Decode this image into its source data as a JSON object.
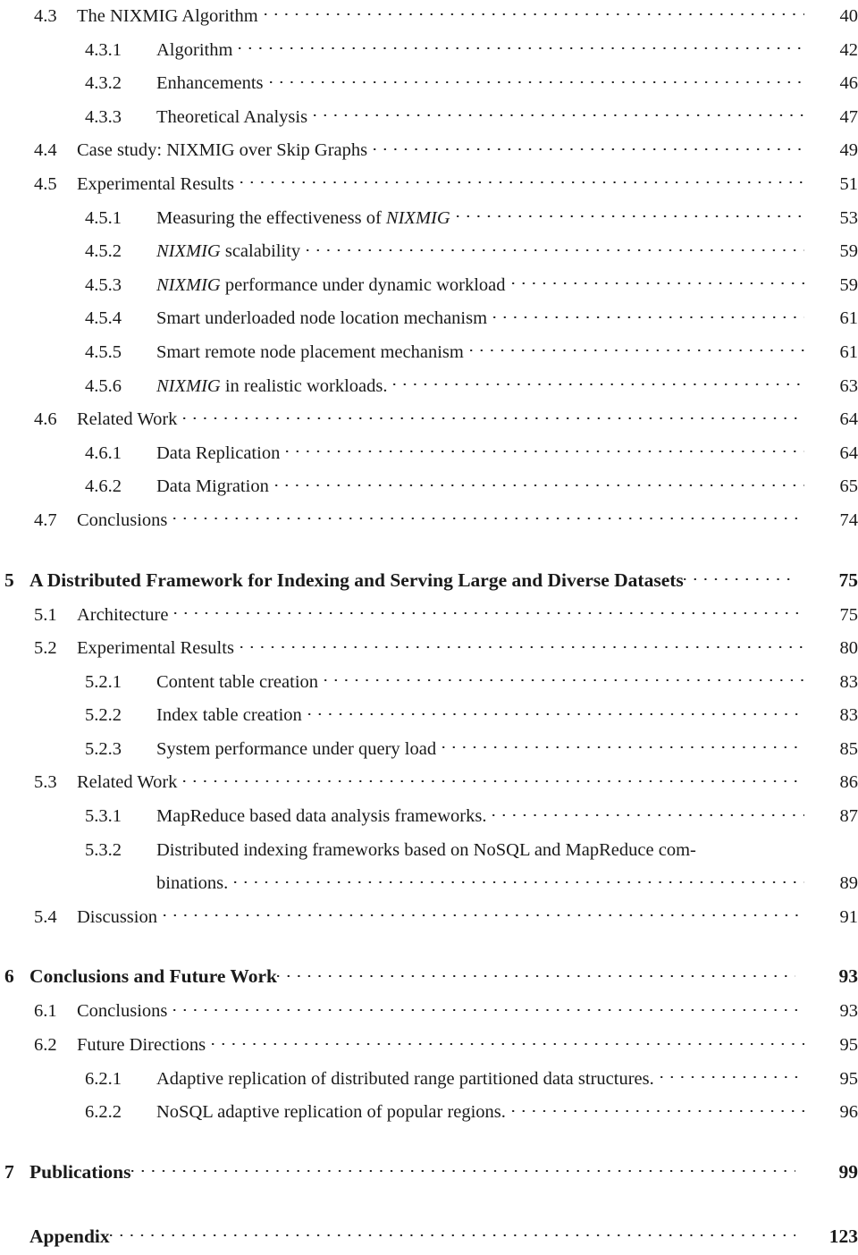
{
  "document": {
    "page_kind": "table-of-contents",
    "text_color": "#1a1a1a",
    "background_color": "#ffffff"
  },
  "entries": [
    {
      "level": "section",
      "number": "4.3",
      "title": "The NIXMIG Algorithm",
      "page": "40"
    },
    {
      "level": "subsection",
      "number": "4.3.1",
      "title": "Algorithm",
      "page": "42"
    },
    {
      "level": "subsection",
      "number": "4.3.2",
      "title": "Enhancements",
      "page": "46"
    },
    {
      "level": "subsection",
      "number": "4.3.3",
      "title": "Theoretical Analysis",
      "page": "47"
    },
    {
      "level": "section",
      "number": "4.4",
      "title": "Case study: NIXMIG over Skip Graphs",
      "page": "49"
    },
    {
      "level": "section",
      "number": "4.5",
      "title": "Experimental Results",
      "page": "51"
    },
    {
      "level": "subsection",
      "number": "4.5.1",
      "title": "Measuring the effectiveness of NIXMIG",
      "title_italic_part": "NIXMIG",
      "title_prefix": "Measuring the effectiveness of ",
      "title_suffix": "",
      "page": "53"
    },
    {
      "level": "subsection",
      "number": "4.5.2",
      "title": "NIXMIG scalability",
      "title_italic_part": "NIXMIG",
      "title_prefix": "",
      "title_suffix": " scalability",
      "page": "59"
    },
    {
      "level": "subsection",
      "number": "4.5.3",
      "title": "NIXMIG performance under dynamic workload",
      "title_italic_part": "NIXMIG",
      "title_prefix": "",
      "title_suffix": " performance under dynamic workload",
      "page": "59"
    },
    {
      "level": "subsection",
      "number": "4.5.4",
      "title": "Smart underloaded node location mechanism",
      "page": "61"
    },
    {
      "level": "subsection",
      "number": "4.5.5",
      "title": "Smart remote node placement mechanism",
      "page": "61"
    },
    {
      "level": "subsection",
      "number": "4.5.6",
      "title": "NIXMIG in realistic workloads.",
      "title_italic_part": "NIXMIG",
      "title_prefix": "",
      "title_suffix": " in realistic workloads.",
      "page": "63"
    },
    {
      "level": "section",
      "number": "4.6",
      "title": "Related Work",
      "page": "64"
    },
    {
      "level": "subsection",
      "number": "4.6.1",
      "title": "Data Replication",
      "page": "64"
    },
    {
      "level": "subsection",
      "number": "4.6.2",
      "title": "Data Migration",
      "page": "65"
    },
    {
      "level": "section",
      "number": "4.7",
      "title": "Conclusions",
      "page": "74"
    },
    {
      "level": "chapter",
      "number": "5",
      "title": "A Distributed Framework for Indexing and Serving Large and Diverse Datasets",
      "page": "75"
    },
    {
      "level": "section",
      "number": "5.1",
      "title": "Architecture",
      "page": "75"
    },
    {
      "level": "section",
      "number": "5.2",
      "title": "Experimental Results",
      "page": "80"
    },
    {
      "level": "subsection",
      "number": "5.2.1",
      "title": "Content table creation",
      "page": "83"
    },
    {
      "level": "subsection",
      "number": "5.2.2",
      "title": "Index table creation",
      "page": "83"
    },
    {
      "level": "subsection",
      "number": "5.2.3",
      "title": "System performance under query load",
      "page": "85"
    },
    {
      "level": "section",
      "number": "5.3",
      "title": "Related Work",
      "page": "86"
    },
    {
      "level": "subsection",
      "number": "5.3.1",
      "title": "MapReduce based data analysis frameworks.",
      "page": "87"
    },
    {
      "level": "subsection",
      "number": "5.3.2",
      "title": "Distributed indexing frameworks based on NoSQL and MapReduce com-",
      "page": ""
    },
    {
      "level": "continuation",
      "number": "",
      "title": "binations.",
      "page": "89"
    },
    {
      "level": "section",
      "number": "5.4",
      "title": "Discussion",
      "page": "91"
    },
    {
      "level": "chapter",
      "number": "6",
      "title": "Conclusions and Future Work",
      "page": "93"
    },
    {
      "level": "section",
      "number": "6.1",
      "title": "Conclusions",
      "page": "93"
    },
    {
      "level": "section",
      "number": "6.2",
      "title": "Future Directions",
      "page": "95"
    },
    {
      "level": "subsection",
      "number": "6.2.1",
      "title": "Adaptive replication of distributed range partitioned data structures.",
      "page": "95"
    },
    {
      "level": "subsection",
      "number": "6.2.2",
      "title": "NoSQL adaptive replication of popular regions.",
      "page": "96"
    },
    {
      "level": "chapter",
      "number": "7",
      "title": "Publications",
      "page": "99"
    },
    {
      "level": "appendix",
      "number": "",
      "title": "Appendix",
      "page": "123"
    }
  ]
}
